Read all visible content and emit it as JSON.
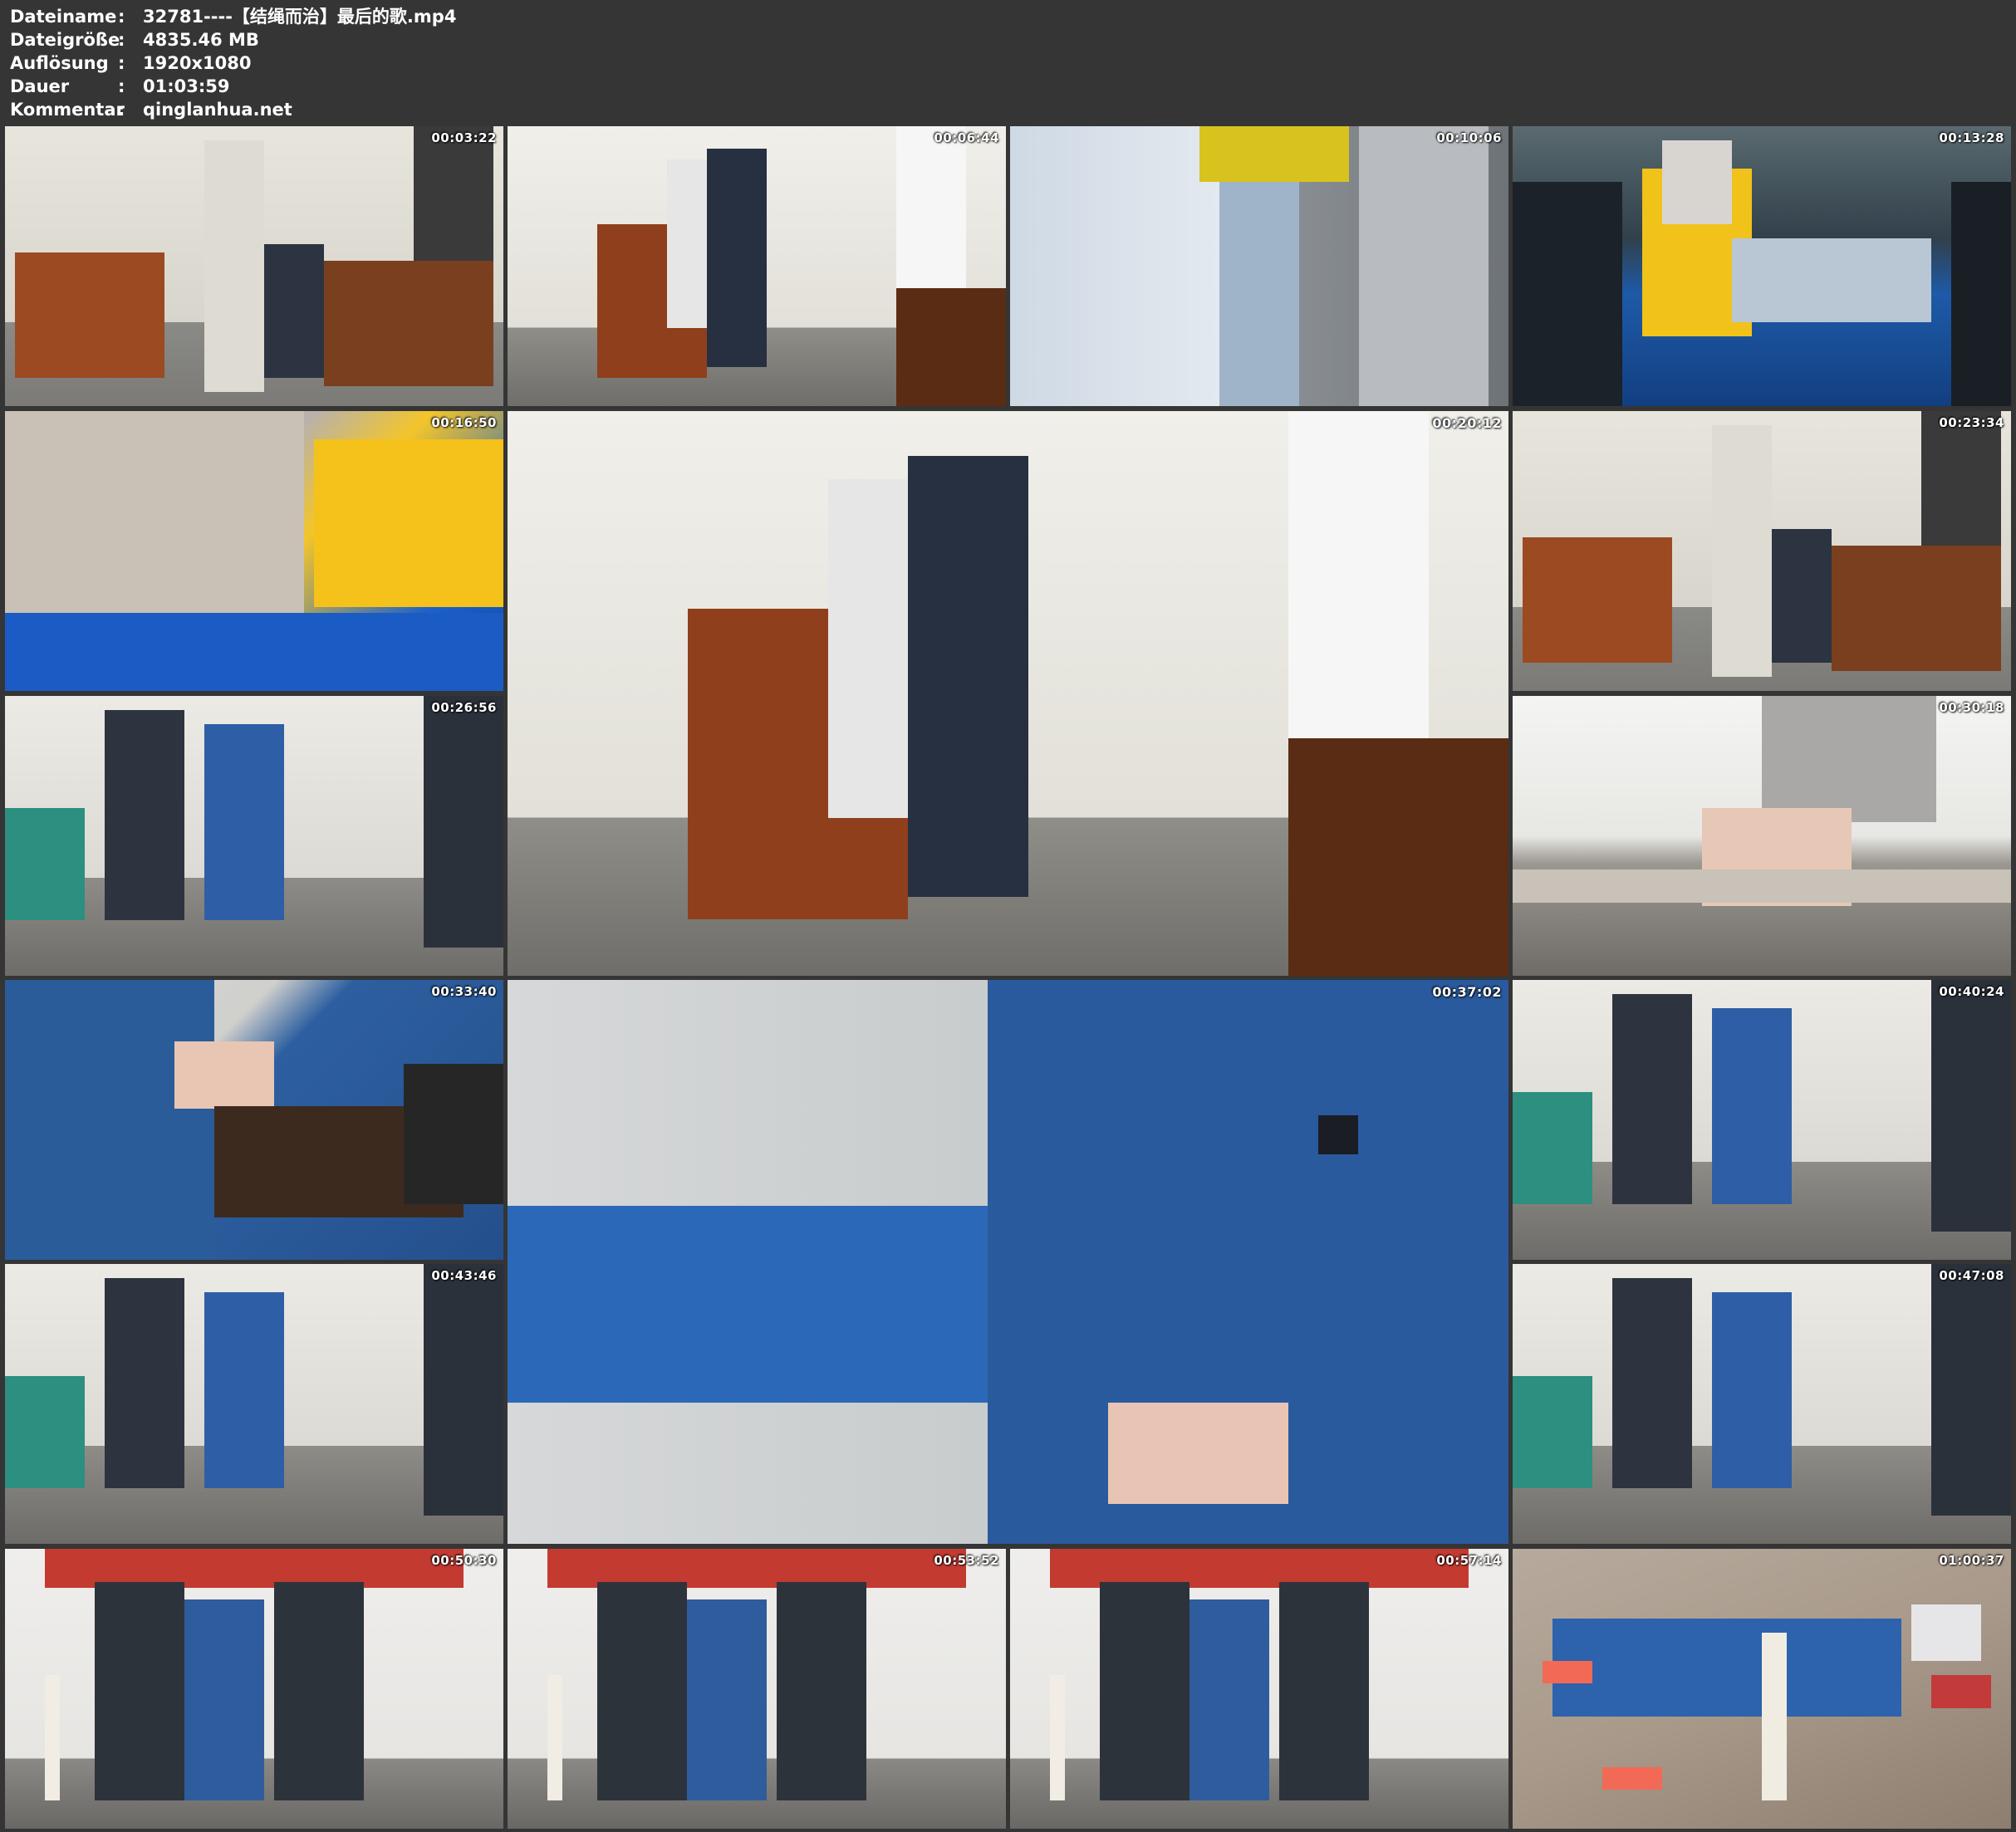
{
  "header": {
    "rows": [
      {
        "label": "Dateiname",
        "sep": ":",
        "value": "32781----【结绳而治】最后的歌.mp4"
      },
      {
        "label": "Dateigröße",
        "sep": ":",
        "value": "4835.46 MB"
      },
      {
        "label": "Auflösung",
        "sep": ":",
        "value": "1920x1080"
      },
      {
        "label": "Dauer",
        "sep": ":",
        "value": "01:03:59"
      },
      {
        "label": "Kommentar",
        "sep": ":",
        "value": "qinglanhua.net"
      }
    ]
  },
  "thumbnails": [
    {
      "timestamp": "00:03:22",
      "scene": "wall"
    },
    {
      "timestamp": "00:06:44",
      "scene": "wall2"
    },
    {
      "timestamp": "00:10:06",
      "scene": "cell"
    },
    {
      "timestamp": "00:13:28",
      "scene": "bed"
    },
    {
      "timestamp": "00:16:50",
      "scene": "face"
    },
    {
      "timestamp": "00:20:12",
      "scene": "wall2"
    },
    {
      "timestamp": "00:23:34",
      "scene": "wall"
    },
    {
      "timestamp": "00:26:56",
      "scene": "room"
    },
    {
      "timestamp": "00:30:18",
      "scene": "foot"
    },
    {
      "timestamp": "00:33:40",
      "scene": "blue"
    },
    {
      "timestamp": "00:37:02",
      "scene": "blue2"
    },
    {
      "timestamp": "00:40:24",
      "scene": "room"
    },
    {
      "timestamp": "00:43:46",
      "scene": "room"
    },
    {
      "timestamp": "00:47:08",
      "scene": "room"
    },
    {
      "timestamp": "00:50:30",
      "scene": "banner"
    },
    {
      "timestamp": "00:53:52",
      "scene": "banner"
    },
    {
      "timestamp": "00:57:14",
      "scene": "banner"
    },
    {
      "timestamp": "01:00:37",
      "scene": "ground"
    }
  ],
  "colors": {
    "background": "#353535",
    "text": "#ffffff"
  }
}
